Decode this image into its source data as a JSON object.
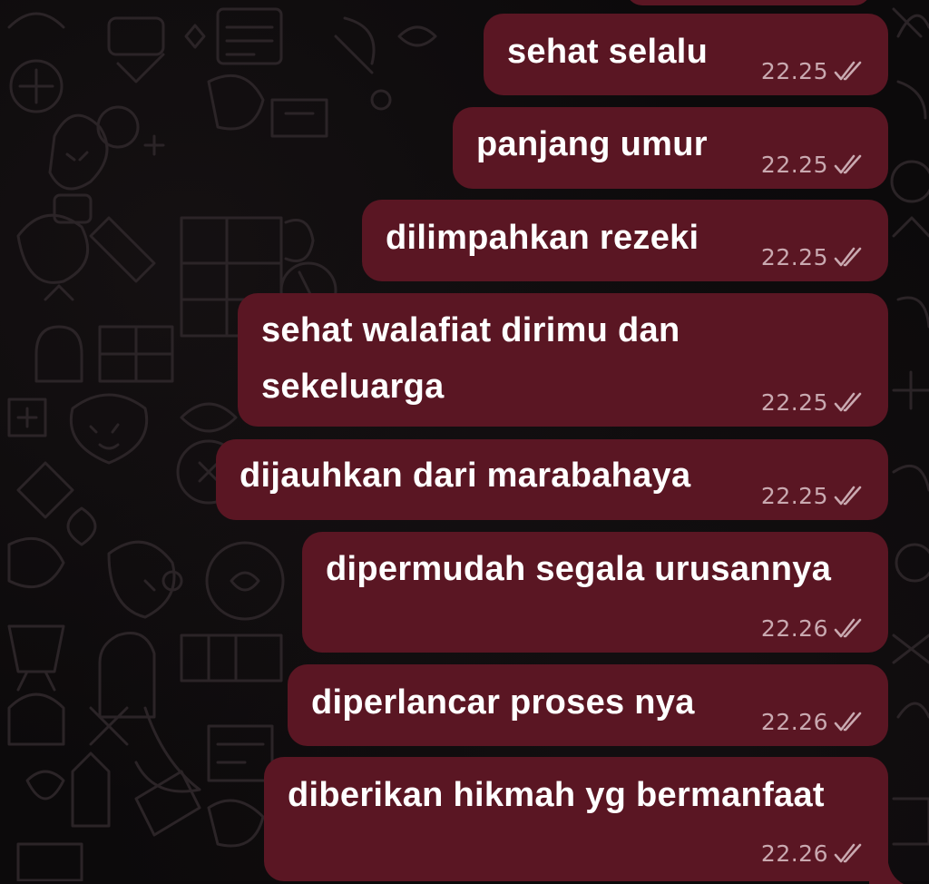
{
  "theme": {
    "bubble_color": "#5a1623",
    "text_color": "#ffffff",
    "meta_color": "#c9a9b0",
    "background_color": "#0c0a0b",
    "doodle_color": "#2b2427"
  },
  "messages": [
    {
      "text": "sehat selalu",
      "time": "22.25",
      "status": "read-double-check-icon"
    },
    {
      "text": "panjang umur",
      "time": "22.25",
      "status": "read-double-check-icon"
    },
    {
      "text": "dilimpahkan rezeki",
      "time": "22.25",
      "status": "read-double-check-icon"
    },
    {
      "text": "sehat walafiat dirimu dan sekeluarga",
      "time": "22.25",
      "status": "read-double-check-icon"
    },
    {
      "text": "dijauhkan dari marabahaya",
      "time": "22.25",
      "status": "read-double-check-icon"
    },
    {
      "text": "dipermudah segala urusannya",
      "time": "22.26",
      "status": "read-double-check-icon"
    },
    {
      "text": "diperlancar proses nya",
      "time": "22.26",
      "status": "read-double-check-icon"
    },
    {
      "text": "diberikan hikmah yg bermanfaat",
      "time": "22.26",
      "status": "read-double-check-icon"
    }
  ]
}
